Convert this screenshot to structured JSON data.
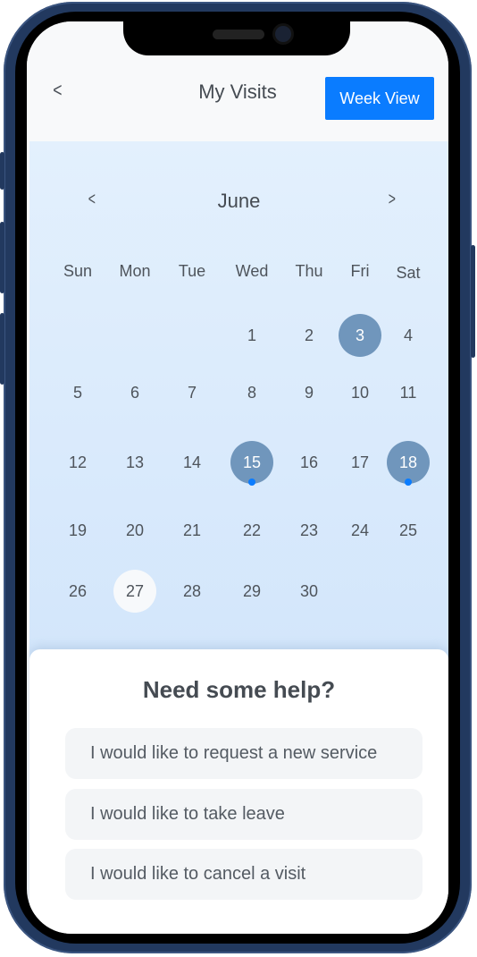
{
  "header": {
    "back_icon": "chevron-left",
    "back_glyph": "<",
    "title": "My Visits",
    "week_view_label": "Week View"
  },
  "calendar": {
    "month": "June",
    "prev_glyph": "<",
    "next_glyph": ">",
    "weekdays": [
      "Sun",
      "Mon",
      "Tue",
      "Wed",
      "Thu",
      "Fri",
      "Sat"
    ],
    "first_weekday_index": 3,
    "days_in_month": 30,
    "visit_days": [
      3,
      15,
      18
    ],
    "days_with_event_dot": [
      15,
      18
    ],
    "today": 27,
    "colors": {
      "visit": "#7096bc",
      "event_dot": "#0a7cff",
      "today": "#f7f9fb"
    }
  },
  "help": {
    "title": "Need some help?",
    "options": [
      "I would like to request a new service",
      "I would like to take leave",
      "I would like to cancel a visit"
    ]
  },
  "colors": {
    "accent": "#0a7cff",
    "frame": "#22395f"
  }
}
